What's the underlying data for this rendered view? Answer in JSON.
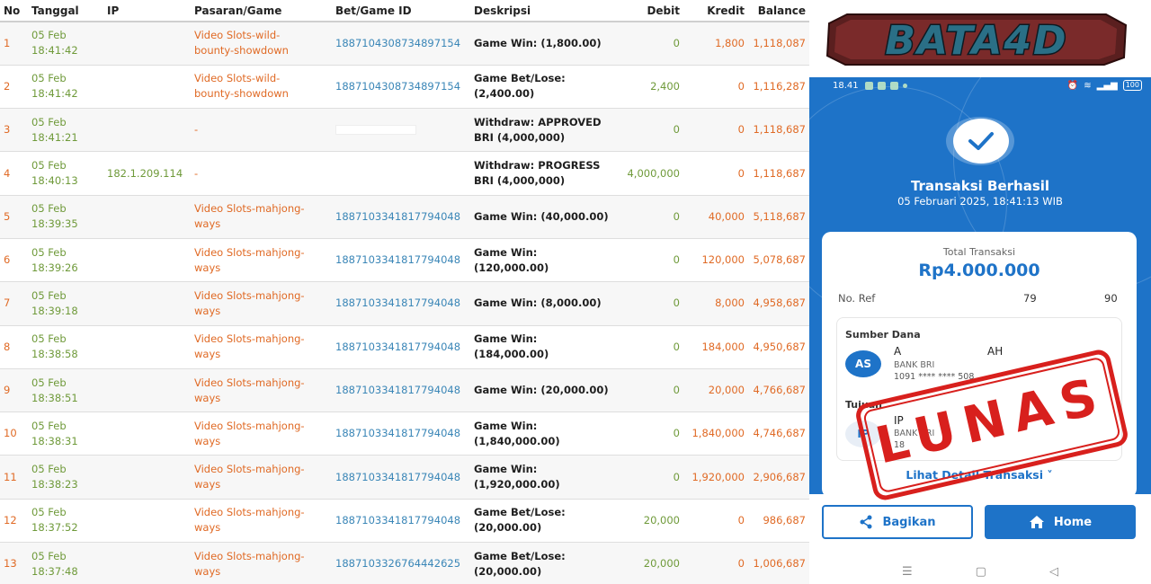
{
  "table": {
    "headers": {
      "no": "No",
      "tanggal": "Tanggal",
      "ip": "IP",
      "game": "Pasaran/Game",
      "bet": "Bet/Game ID",
      "desc": "Deskripsi",
      "debit": "Debit",
      "kredit": "Kredit",
      "balance": "Balance"
    },
    "rows": [
      {
        "no": "1",
        "date": "05 Feb",
        "time": "18:41:42",
        "ip": "",
        "game1": "Video Slots-wild-",
        "game2": "bounty-showdown",
        "bet": "1887104308734897154",
        "desc1": "Game Win: (1,800.00)",
        "desc2": "",
        "debit": "0",
        "kredit": "1,800",
        "balance": "1,118,087"
      },
      {
        "no": "2",
        "date": "05 Feb",
        "time": "18:41:42",
        "ip": "",
        "game1": "Video Slots-wild-",
        "game2": "bounty-showdown",
        "bet": "1887104308734897154",
        "desc1": "Game Bet/Lose:",
        "desc2": "(2,400.00)",
        "debit": "2,400",
        "kredit": "0",
        "balance": "1,116,287"
      },
      {
        "no": "3",
        "date": "05 Feb",
        "time": "18:41:21",
        "ip": "",
        "game1": "-",
        "game2": "",
        "bet": "",
        "desc1": "Withdraw: APPROVED",
        "desc2": "BRI (4,000,000)",
        "debit": "0",
        "kredit": "0",
        "balance": "1,118,687"
      },
      {
        "no": "4",
        "date": "05 Feb",
        "time": "18:40:13",
        "ip": "182.1.209.114",
        "game1": "-",
        "game2": "",
        "bet": "",
        "desc1": "Withdraw: PROGRESS",
        "desc2": "BRI (4,000,000)",
        "debit": "4,000,000",
        "kredit": "0",
        "balance": "1,118,687"
      },
      {
        "no": "5",
        "date": "05 Feb",
        "time": "18:39:35",
        "ip": "",
        "game1": "Video Slots-mahjong-",
        "game2": "ways",
        "bet": "1887103341817794048",
        "desc1": "Game Win: (40,000.00)",
        "desc2": "",
        "debit": "0",
        "kredit": "40,000",
        "balance": "5,118,687"
      },
      {
        "no": "6",
        "date": "05 Feb",
        "time": "18:39:26",
        "ip": "",
        "game1": "Video Slots-mahjong-",
        "game2": "ways",
        "bet": "1887103341817794048",
        "desc1": "Game Win: (120,000.00)",
        "desc2": "",
        "debit": "0",
        "kredit": "120,000",
        "balance": "5,078,687"
      },
      {
        "no": "7",
        "date": "05 Feb",
        "time": "18:39:18",
        "ip": "",
        "game1": "Video Slots-mahjong-",
        "game2": "ways",
        "bet": "1887103341817794048",
        "desc1": "Game Win: (8,000.00)",
        "desc2": "",
        "debit": "0",
        "kredit": "8,000",
        "balance": "4,958,687"
      },
      {
        "no": "8",
        "date": "05 Feb",
        "time": "18:38:58",
        "ip": "",
        "game1": "Video Slots-mahjong-",
        "game2": "ways",
        "bet": "1887103341817794048",
        "desc1": "Game Win: (184,000.00)",
        "desc2": "",
        "debit": "0",
        "kredit": "184,000",
        "balance": "4,950,687"
      },
      {
        "no": "9",
        "date": "05 Feb",
        "time": "18:38:51",
        "ip": "",
        "game1": "Video Slots-mahjong-",
        "game2": "ways",
        "bet": "1887103341817794048",
        "desc1": "Game Win: (20,000.00)",
        "desc2": "",
        "debit": "0",
        "kredit": "20,000",
        "balance": "4,766,687"
      },
      {
        "no": "10",
        "date": "05 Feb",
        "time": "18:38:31",
        "ip": "",
        "game1": "Video Slots-mahjong-",
        "game2": "ways",
        "bet": "1887103341817794048",
        "desc1": "Game Win:",
        "desc2": "(1,840,000.00)",
        "debit": "0",
        "kredit": "1,840,000",
        "balance": "4,746,687"
      },
      {
        "no": "11",
        "date": "05 Feb",
        "time": "18:38:23",
        "ip": "",
        "game1": "Video Slots-mahjong-",
        "game2": "ways",
        "bet": "1887103341817794048",
        "desc1": "Game Win:",
        "desc2": "(1,920,000.00)",
        "debit": "0",
        "kredit": "1,920,000",
        "balance": "2,906,687"
      },
      {
        "no": "12",
        "date": "05 Feb",
        "time": "18:37:52",
        "ip": "",
        "game1": "Video Slots-mahjong-",
        "game2": "ways",
        "bet": "1887103341817794048",
        "desc1": "Game Bet/Lose:",
        "desc2": "(20,000.00)",
        "debit": "20,000",
        "kredit": "0",
        "balance": "986,687"
      },
      {
        "no": "13",
        "date": "05 Feb",
        "time": "18:37:48",
        "ip": "",
        "game1": "Video Slots-mahjong-",
        "game2": "ways",
        "bet": "1887103326764442625",
        "desc1": "Game Bet/Lose:",
        "desc2": "(20,000.00)",
        "debit": "20,000",
        "kredit": "0",
        "balance": "1,006,687"
      }
    ]
  },
  "logo": {
    "text": "BATA4D"
  },
  "phone": {
    "status_time": "18.41",
    "battery": "100",
    "title": "Transaksi Berhasil",
    "date": "05 Februari 2025, 18:41:13 WIB",
    "total_label": "Total Transaksi",
    "total_amount": "Rp4.000.000",
    "ref_label": "No. Ref",
    "ref_part1": "79",
    "ref_part2": "90",
    "sumber_label": "Sumber Dana",
    "sumber_initials": "AS",
    "sumber_name1": "A",
    "sumber_name2": "AH",
    "sumber_bank": "BANK BRI",
    "sumber_account": "1091 **** **** 508",
    "tujuan_label": "Tujuan",
    "tujuan_initials": "IP",
    "tujuan_name": "IP",
    "tujuan_bank": "BANK BRI",
    "tujuan_account": "18",
    "detail_link": "Lihat Detail Transaksi ˅",
    "share_label": "Bagikan",
    "home_label": "Home"
  },
  "stamp": {
    "text": "LUNAS"
  },
  "colors": {
    "brand_blue": "#1e73c8",
    "stamp_red": "#d8201d",
    "orange_text": "#e06a25",
    "green_text": "#6f9a3a",
    "id_blue": "#3a86b7"
  }
}
